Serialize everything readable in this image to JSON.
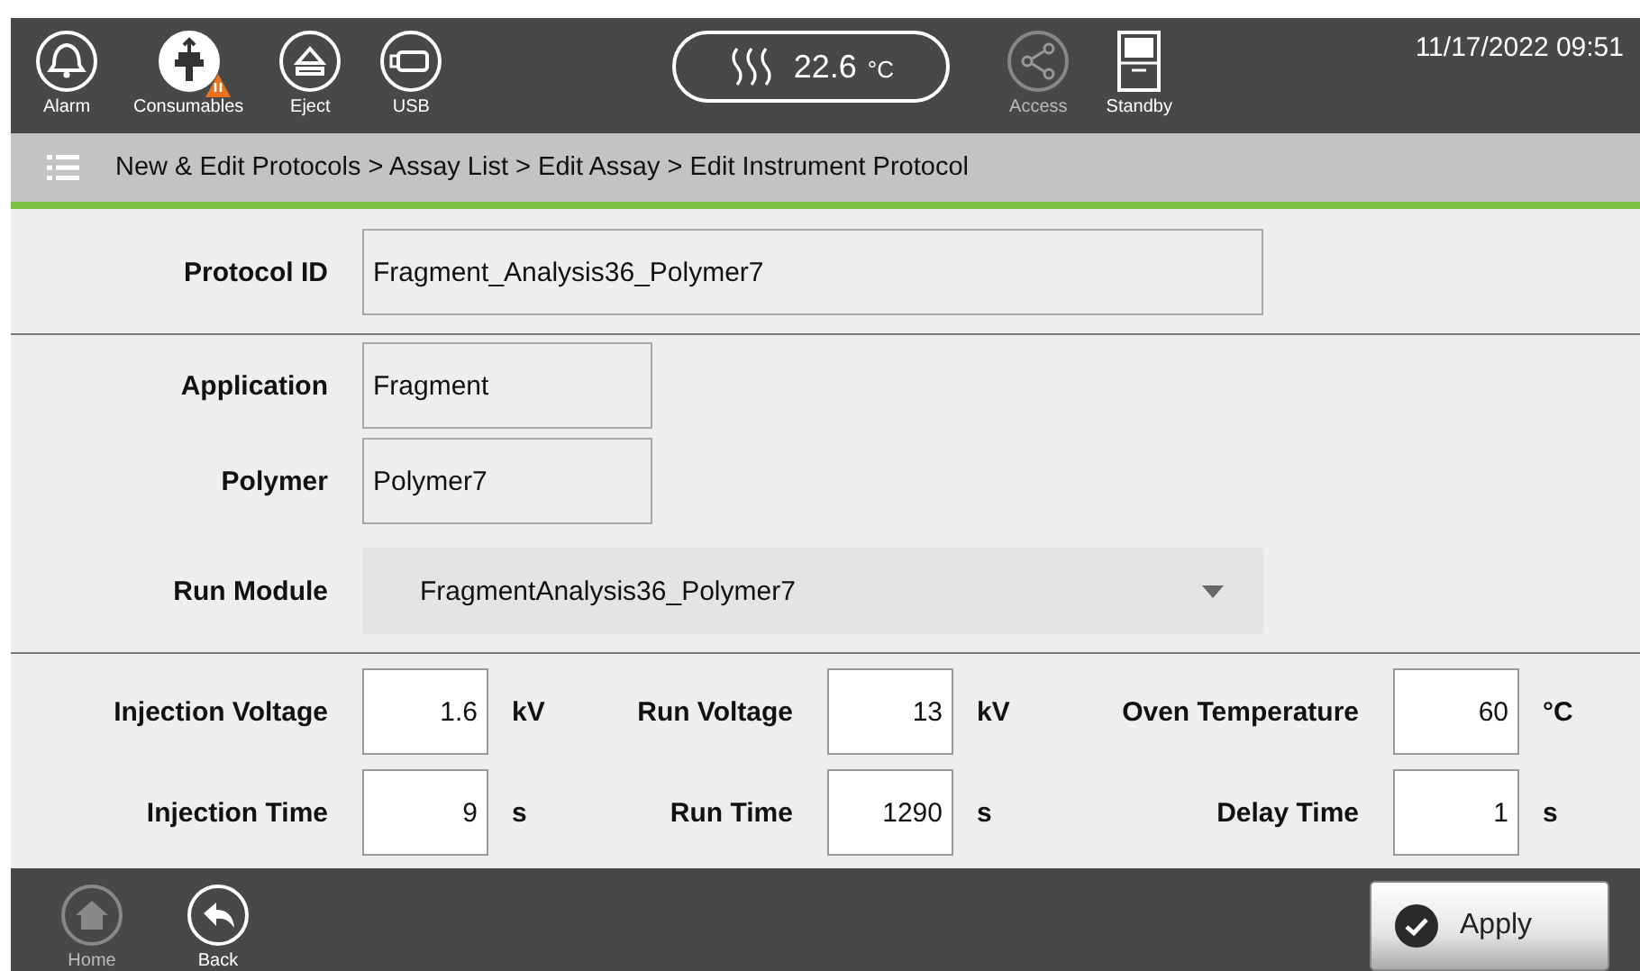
{
  "header": {
    "buttons": [
      {
        "kind": "alarm",
        "label": "Alarm",
        "warning": false,
        "disabled": false
      },
      {
        "kind": "consumables",
        "label": "Consumables",
        "warning": true,
        "disabled": false
      },
      {
        "kind": "eject",
        "label": "Eject",
        "warning": false,
        "disabled": false
      },
      {
        "kind": "usb",
        "label": "USB",
        "warning": false,
        "disabled": false
      }
    ],
    "temperature": "22.6",
    "temperature_unit": "°C",
    "buttons_right": [
      {
        "kind": "access",
        "label": "Access",
        "warning": false,
        "disabled": true
      },
      {
        "kind": "standby",
        "label": "Standby",
        "warning": false,
        "disabled": false
      }
    ],
    "datetime": "11/17/2022 09:51"
  },
  "breadcrumb": "New & Edit Protocols > Assay List > Edit Assay > Edit Instrument Protocol",
  "protocol_id": {
    "label": "Protocol ID",
    "value": "Fragment_Analysis36_Polymer7"
  },
  "fields": [
    {
      "label": "Application",
      "value": "Fragment",
      "kind": "readonly"
    },
    {
      "label": "Polymer",
      "value": "Polymer7",
      "kind": "readonly"
    },
    {
      "label": "Run Module",
      "value": "FragmentAnalysis36_Polymer7",
      "kind": "dropdown"
    }
  ],
  "parameters": [
    {
      "label": "Injection Voltage",
      "value": "1.6",
      "unit": "kV"
    },
    {
      "label": "Run Voltage",
      "value": "13",
      "unit": "kV"
    },
    {
      "label": "Oven Temperature",
      "value": "60",
      "unit": "°C"
    },
    {
      "label": "Injection Time",
      "value": "9",
      "unit": "s"
    },
    {
      "label": "Run Time",
      "value": "1290",
      "unit": "s"
    },
    {
      "label": "Delay Time",
      "value": "1",
      "unit": "s"
    }
  ],
  "footer": {
    "buttons": [
      {
        "kind": "home",
        "label": "Home",
        "disabled": true
      },
      {
        "kind": "back",
        "label": "Back",
        "disabled": false
      }
    ],
    "apply": "Apply"
  }
}
